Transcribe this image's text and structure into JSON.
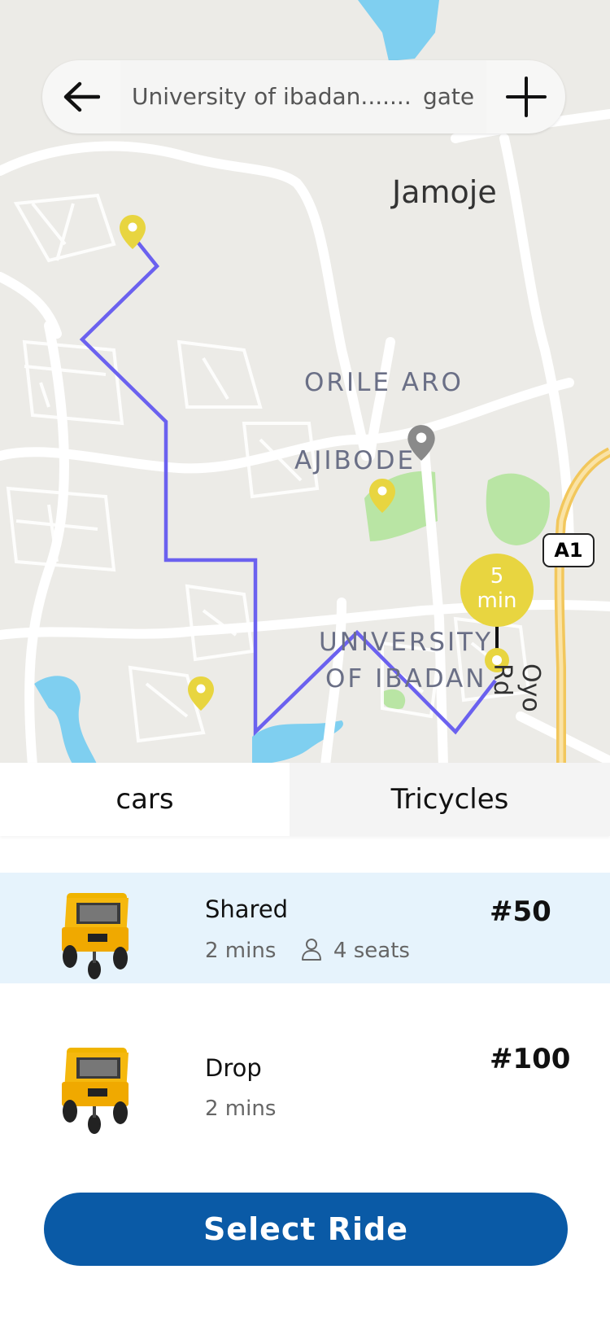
{
  "search": {
    "origin_text": "University of ibadan.......",
    "destination_text": "gate"
  },
  "map": {
    "labels": {
      "jamoje": "Jamoje",
      "orile_aro": "ORILE ARO",
      "ajibode": "AJIBODE",
      "university_line1": "UNIVERSITY",
      "university_line2": "OF IBADAN",
      "highway": "A1",
      "road": "Oyo Rd"
    },
    "eta": {
      "value": "5",
      "unit": "min"
    },
    "route_color": "#6b61ef",
    "pin_color": "#e8d540"
  },
  "tabs": [
    {
      "label": "cars",
      "active": true
    },
    {
      "label": "Tricycles",
      "active": false
    }
  ],
  "rides": [
    {
      "name": "Shared",
      "eta": "2 mins",
      "seats": "4 seats",
      "price": "#50",
      "selected": true
    },
    {
      "name": "Drop",
      "eta": "2 mins",
      "price": "#100",
      "selected": false
    }
  ],
  "action": {
    "label": "Select Ride"
  },
  "colors": {
    "primary": "#0a5aa6",
    "selected_bg": "#e6f3fc"
  }
}
